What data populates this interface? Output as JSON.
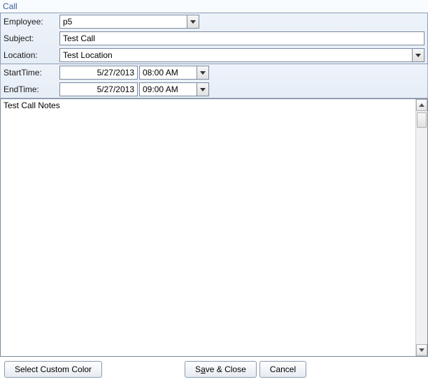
{
  "window": {
    "title": "Call"
  },
  "form": {
    "employee": {
      "label": "Employee:",
      "value": "p5"
    },
    "subject": {
      "label": "Subject:",
      "value": "Test Call"
    },
    "location": {
      "label": "Location:",
      "value": "Test Location"
    }
  },
  "times": {
    "start": {
      "label": "StartTime:",
      "date": "5/27/2013",
      "time": "08:00 AM"
    },
    "end": {
      "label": "EndTime:",
      "date": "5/27/2013",
      "time": "09:00 AM"
    }
  },
  "notes": {
    "value": "Test Call Notes"
  },
  "buttons": {
    "color": "Select Custom Color",
    "save_pre": "S",
    "save_u": "a",
    "save_post": "ve & Close",
    "cancel": "Cancel"
  }
}
